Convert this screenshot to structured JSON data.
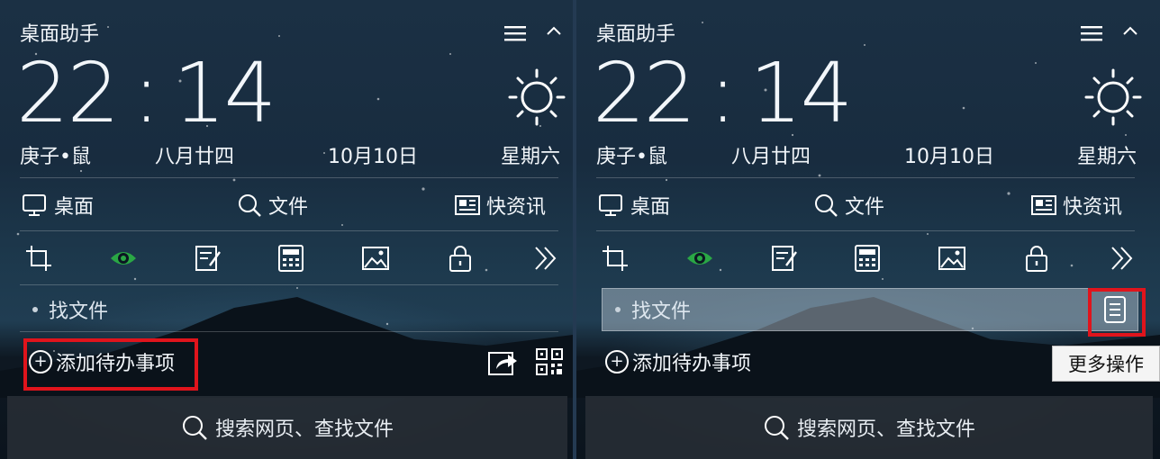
{
  "colors": {
    "highlight": "#e0141c",
    "eye_icon": "#2aa745",
    "text": "#f2f6fa",
    "search_bar": "#262c34"
  },
  "widget": {
    "title": "桌面助手",
    "clock": {
      "hours": "22",
      "minutes": "14"
    },
    "date": {
      "zodiac": "庚子•鼠",
      "lunar": "八月廿四",
      "solar": "10月10日",
      "weekday": "星期六"
    },
    "weather_icon": "sun-icon",
    "nav": [
      {
        "label": "桌面",
        "icon": "monitor-icon"
      },
      {
        "label": "文件",
        "icon": "search-icon"
      },
      {
        "label": "快资讯",
        "icon": "news-icon"
      }
    ],
    "tools": [
      "crop-icon",
      "eye-icon",
      "note-edit-icon",
      "calculator-icon",
      "image-icon",
      "lock-icon",
      "double-chevron-right-icon"
    ],
    "todo_item": "找文件",
    "add_todo": "添加待办事项",
    "search_placeholder": "搜索网页、查找文件",
    "more_tooltip": "更多操作"
  }
}
